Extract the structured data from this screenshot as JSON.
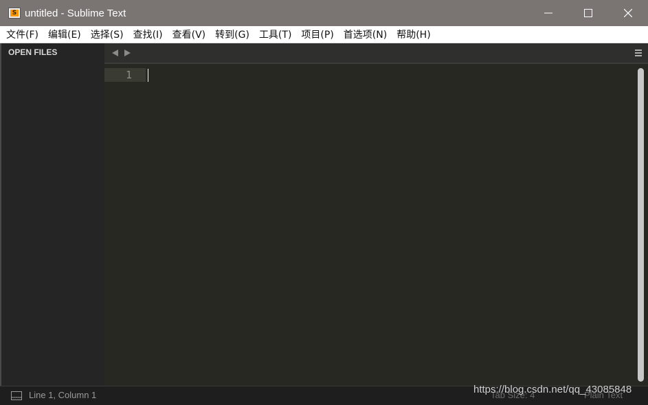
{
  "window": {
    "title": "untitled - Sublime Text",
    "app_icon_letter": "S",
    "controls": [
      "minimize-icon",
      "maximize-icon",
      "close-icon"
    ]
  },
  "menu": {
    "items": [
      {
        "label": "文件(F)"
      },
      {
        "label": "编辑(E)"
      },
      {
        "label": "选择(S)"
      },
      {
        "label": "查找(I)"
      },
      {
        "label": "查看(V)"
      },
      {
        "label": "转到(G)"
      },
      {
        "label": "工具(T)"
      },
      {
        "label": "项目(P)"
      },
      {
        "label": "首选项(N)"
      },
      {
        "label": "帮助(H)"
      }
    ]
  },
  "sidebar": {
    "heading": "OPEN FILES"
  },
  "tabbar": {
    "prev_icon": "chevron-left-icon",
    "next_icon": "chevron-right-icon",
    "menu_icon": "hamburger-icon"
  },
  "editor": {
    "line_numbers": [
      "1"
    ],
    "content": ""
  },
  "statusbar": {
    "position": "Line 1, Column 1",
    "tab_size": "Tab Size: 4",
    "syntax": "Plain Text"
  },
  "watermark": "https://blog.csdn.net/qq_43085848",
  "colors": {
    "titlebar": "#7a7472",
    "editor_bg": "#272822",
    "sidebar_bg": "#252525",
    "statusbar_bg": "#1e1e1e"
  }
}
